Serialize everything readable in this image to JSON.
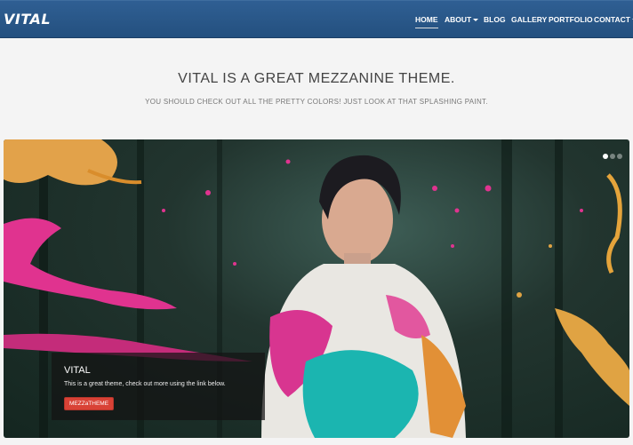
{
  "brand": "VITAL",
  "nav": [
    {
      "label": "HOME",
      "active": true,
      "caret": false
    },
    {
      "label": "ABOUT",
      "active": false,
      "caret": true
    },
    {
      "label": "BLOG",
      "active": false,
      "caret": false
    },
    {
      "label": "GALLERY",
      "active": false,
      "caret": false
    },
    {
      "label": "PORTFOLIO",
      "active": false,
      "caret": false
    },
    {
      "label": "CONTACT",
      "active": false,
      "caret": true
    }
  ],
  "hero": {
    "title": "VITAL IS A GREAT MEZZANINE THEME.",
    "subtitle": "YOU SHOULD CHECK OUT ALL THE PRETTY COLORS! JUST LOOK AT THAT SPLASHING PAINT."
  },
  "slider": {
    "caption_title": "VITAL",
    "caption_text": "This is a great theme, check out more using the link below.",
    "button_label": "MEZZaTHEME",
    "slide_count": 3,
    "active_slide": 1
  }
}
